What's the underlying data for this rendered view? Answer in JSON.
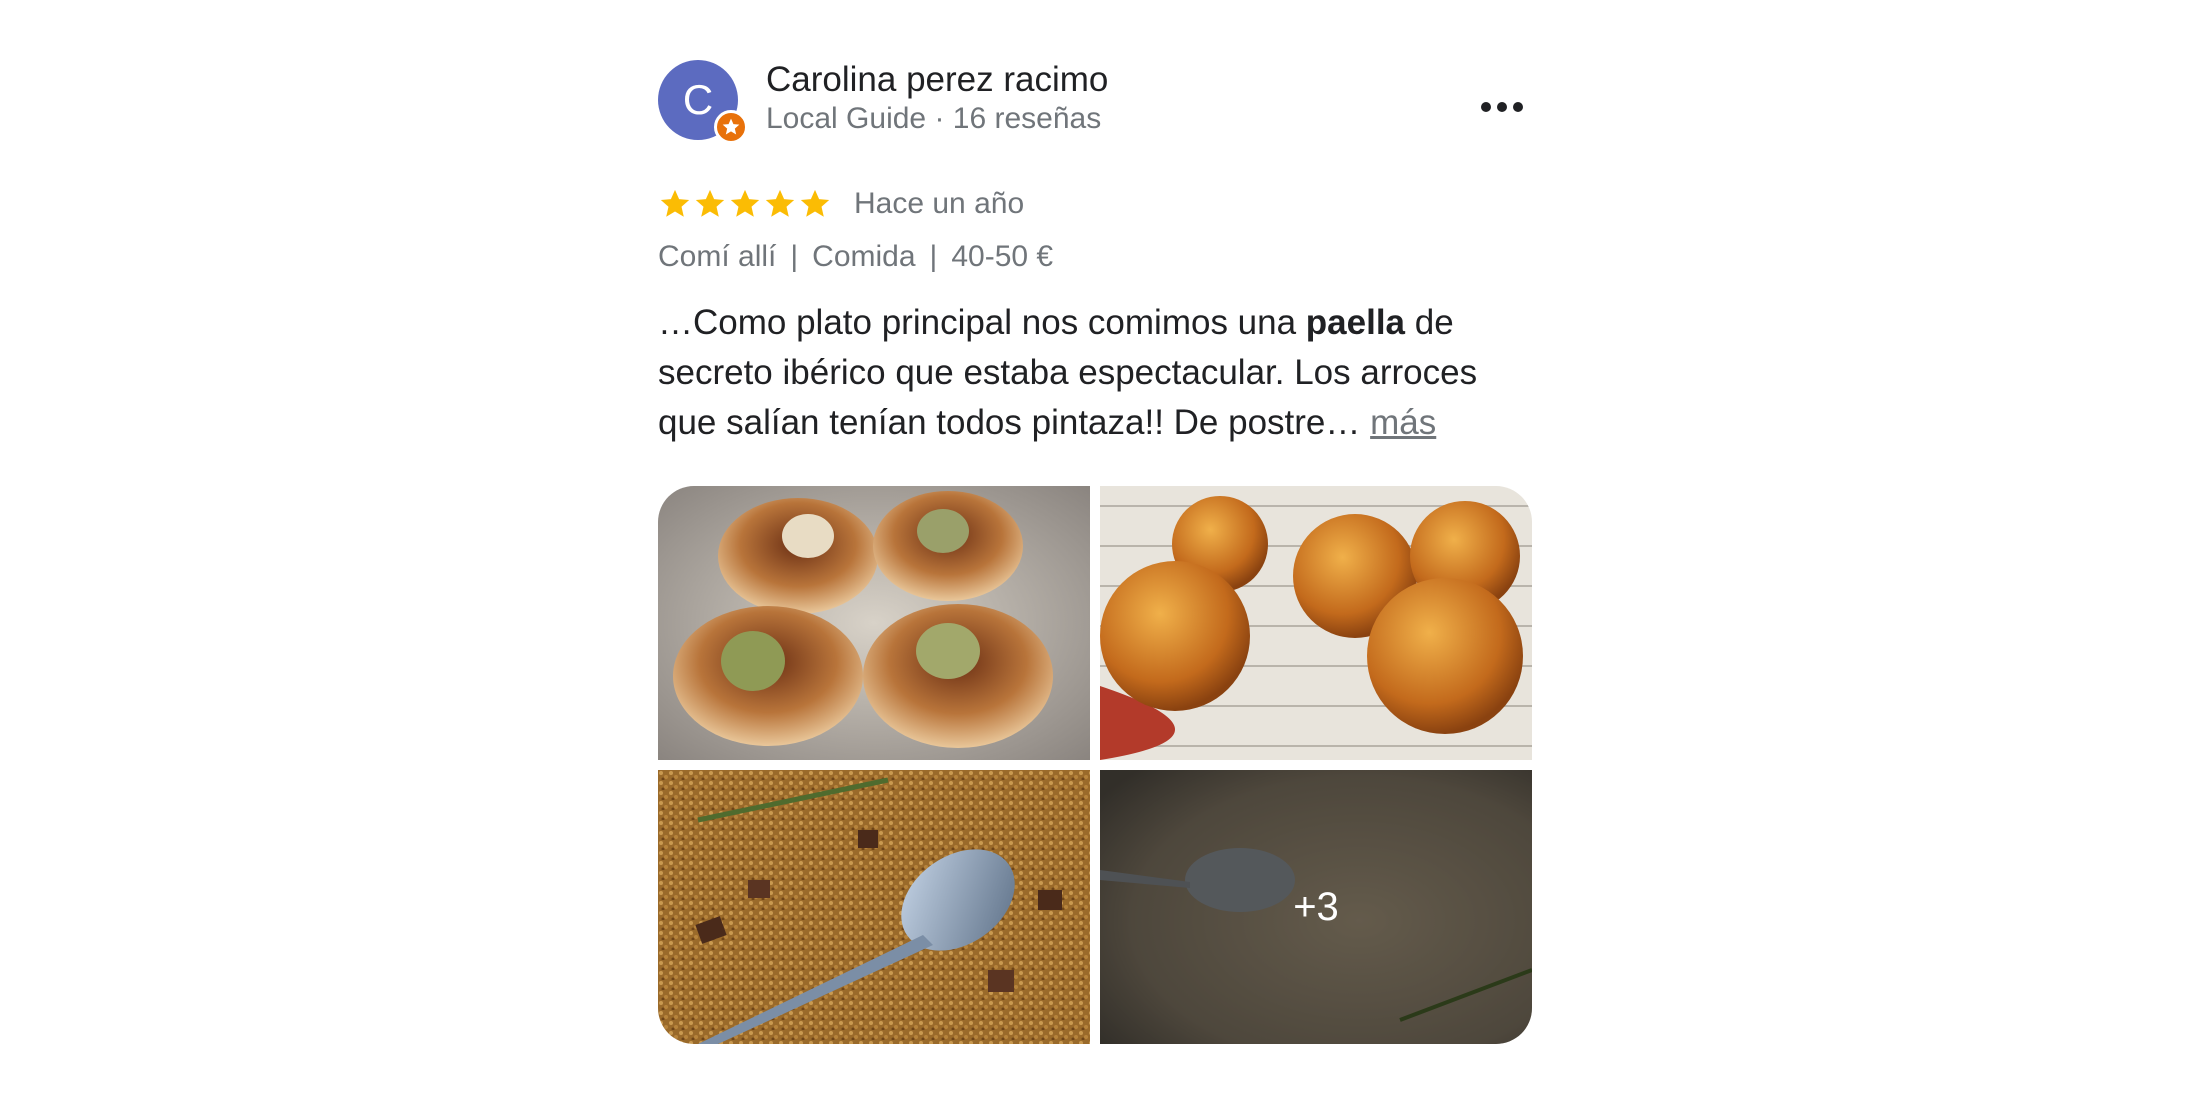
{
  "review": {
    "author": {
      "initial": "C",
      "name": "Carolina perez racimo",
      "meta": "Local Guide · 16 reseñas",
      "avatar_color": "#5c6bc0",
      "badge_color": "#e8710a"
    },
    "rating": {
      "stars": 5,
      "max": 5,
      "star_color": "#fbbc04",
      "date": "Hace un año"
    },
    "attributes": {
      "service": "Comí allí",
      "meal": "Comida",
      "price": "40-50 €",
      "separator": "|"
    },
    "text": {
      "before": "…Como plato principal nos comimos una ",
      "highlight": "paella",
      "after": " de secreto ibérico que estaba espectacular. Los arroces que salían tenían todos pintaza!! De postre… ",
      "more_label": "más"
    },
    "photos": [
      {
        "name": "photo-scallops",
        "icon": "scallops-photo"
      },
      {
        "name": "photo-croquettes",
        "icon": "croquettes-photo"
      },
      {
        "name": "photo-paella",
        "icon": "paella-photo"
      },
      {
        "name": "photo-paella-pan",
        "icon": "paella-pan-photo"
      }
    ],
    "more_photos_label": "+3",
    "menu_icon": "more-options-icon"
  }
}
